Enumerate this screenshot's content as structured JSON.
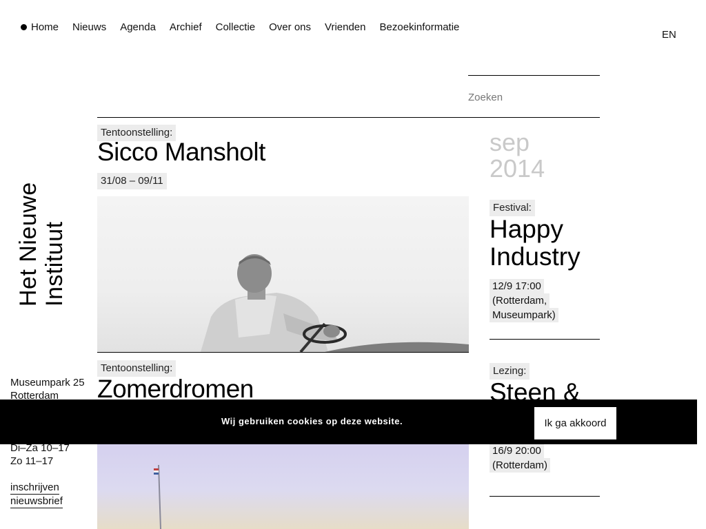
{
  "nav": {
    "items": [
      {
        "label": "Home"
      },
      {
        "label": "Nieuws"
      },
      {
        "label": "Agenda"
      },
      {
        "label": "Archief"
      },
      {
        "label": "Collectie"
      },
      {
        "label": "Over ons"
      },
      {
        "label": "Vrienden"
      },
      {
        "label": "Bezoekinformatie"
      }
    ],
    "active_marker": "bullet-icon",
    "language": "EN"
  },
  "search": {
    "placeholder": "Zoeken"
  },
  "logo": {
    "line1": "Het Nieuwe",
    "line2": "Instituut"
  },
  "sidebar": {
    "address_line1": "Museumpark 25",
    "address_line2": "Rotterdam",
    "hours_line1": "Di–Za 10–17",
    "hours_line2": "Zo 11–17",
    "newsletter_line1": "inschrijven",
    "newsletter_line2": "nieuwsbrief"
  },
  "main": {
    "cards": [
      {
        "tag": "Tentoonstelling:",
        "title": "Sicco Mansholt",
        "date": "31/08 – 09/11",
        "image_icon": "tractor-portrait-photo"
      },
      {
        "tag": "Tentoonstelling:",
        "title": "Zomerdromen",
        "image_icon": "flagpole-photo"
      }
    ]
  },
  "agenda": {
    "month": "sep",
    "year": "2014",
    "events": [
      {
        "tag": "Festival:",
        "title_line1": "Happy",
        "title_line2": "Industry",
        "time": "12/9 17:00",
        "place_line1": "(Rotterdam,",
        "place_line2": "Museumpark)"
      },
      {
        "tag": "Lezing:",
        "title_line1": "Steen &",
        "time": "16/9 20:00",
        "place_line1": "(Rotterdam)"
      }
    ]
  },
  "cookie": {
    "message": "Wij gebruiken cookies op deze website.",
    "accept_label": "Ik ga akkoord"
  },
  "colors": {
    "accent": "#000000",
    "tag_bg": "#ececec",
    "month_color": "#c9c9c9"
  }
}
